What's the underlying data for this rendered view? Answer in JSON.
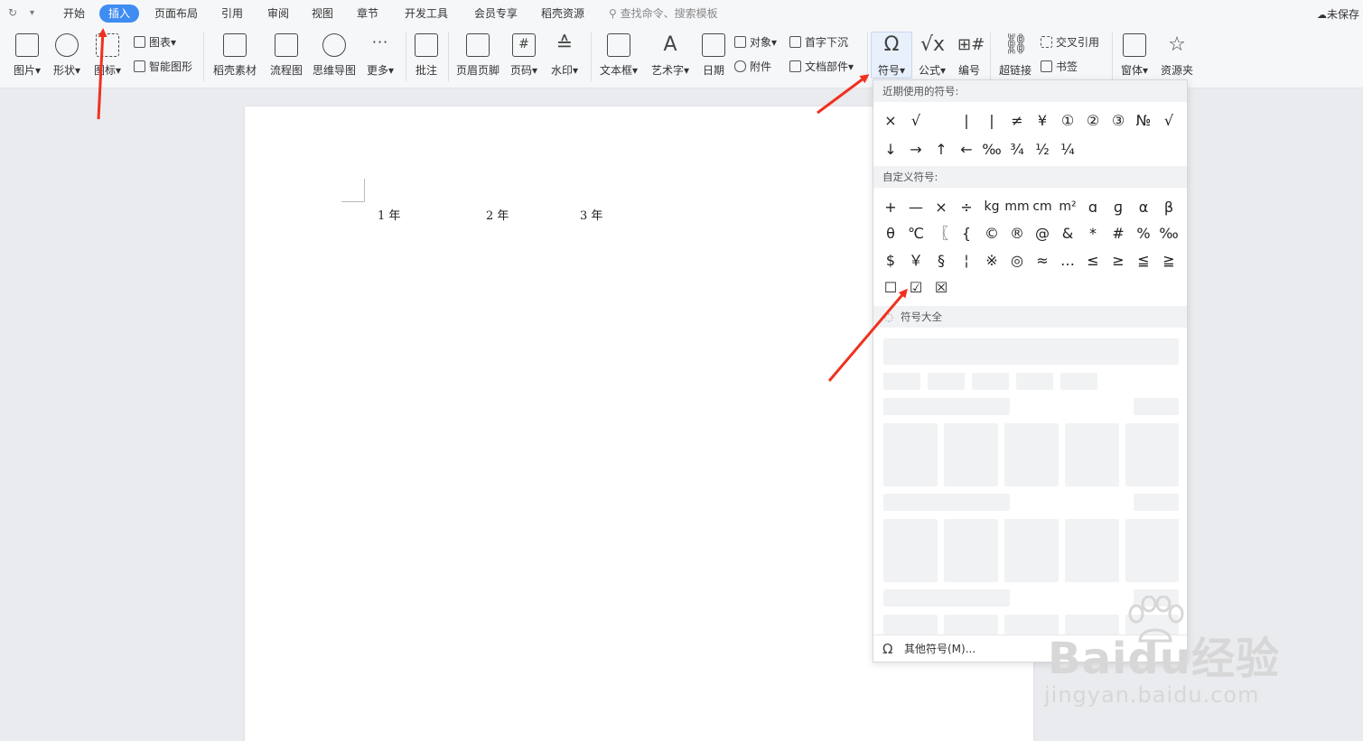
{
  "menubar": {
    "tabs": [
      "开始",
      "插入",
      "页面布局",
      "引用",
      "审阅",
      "视图",
      "章节",
      "开发工具",
      "会员专享",
      "稻壳资源"
    ],
    "active_tab": "插入",
    "search_placeholder": "查找命令、搜索模板",
    "save_status": "未保存"
  },
  "ribbon": {
    "picture": "图片",
    "shape": "形状",
    "icon": "图标",
    "chart": "图表",
    "smart_graphic": "智能图形",
    "docer_material": "稻壳素材",
    "flowchart": "流程图",
    "mindmap": "思维导图",
    "more": "更多",
    "comment": "批注",
    "header_footer": "页眉页脚",
    "page_number": "页码",
    "watermark": "水印",
    "textbox": "文本框",
    "wordart": "艺术字",
    "date": "日期",
    "object": "对象",
    "attachment": "附件",
    "drop_cap": "首字下沉",
    "doc_parts": "文档部件",
    "symbol": "符号",
    "formula": "公式",
    "numbering": "编号",
    "hyperlink": "超链接",
    "cross_ref": "交叉引用",
    "bookmark": "书签",
    "window": "窗体",
    "resource": "资源夹"
  },
  "document": {
    "years": [
      "1 年",
      "2 年",
      "3 年"
    ]
  },
  "symbol_menu": {
    "recent_title": "近期使用的符号:",
    "recent_row1": [
      "×",
      "√",
      "",
      "|",
      "|",
      "≠",
      "¥",
      "①",
      "②",
      "③",
      "№",
      "√"
    ],
    "recent_row2": [
      "↓",
      "→",
      "↑",
      "←",
      "‰",
      "¾",
      "½",
      "¼"
    ],
    "custom_title": "自定义符号:",
    "custom_row1": [
      "+",
      "—",
      "×",
      "÷",
      "kg",
      "mm",
      "cm",
      "m²",
      "ɑ",
      "ɡ",
      "α",
      "β"
    ],
    "custom_row2": [
      "θ",
      "℃",
      "〖",
      "{",
      "©",
      "®",
      "@",
      "&",
      "*",
      "#",
      "%",
      "‰"
    ],
    "custom_row3": [
      "$",
      "￥",
      "§",
      "¦",
      "※",
      "◎",
      "≈",
      "…",
      "≤",
      "≥",
      "≦",
      "≧"
    ],
    "custom_row4": [
      "☐",
      "☑",
      "☒"
    ],
    "all_symbols_title": "符号大全",
    "other_symbols": "其他符号(M)..."
  },
  "watermark": {
    "brand": "Baidu经验",
    "url": "jingyan.baidu.com"
  },
  "colors": {
    "accent": "#3f8cf2",
    "arrow": "#f0311f"
  }
}
